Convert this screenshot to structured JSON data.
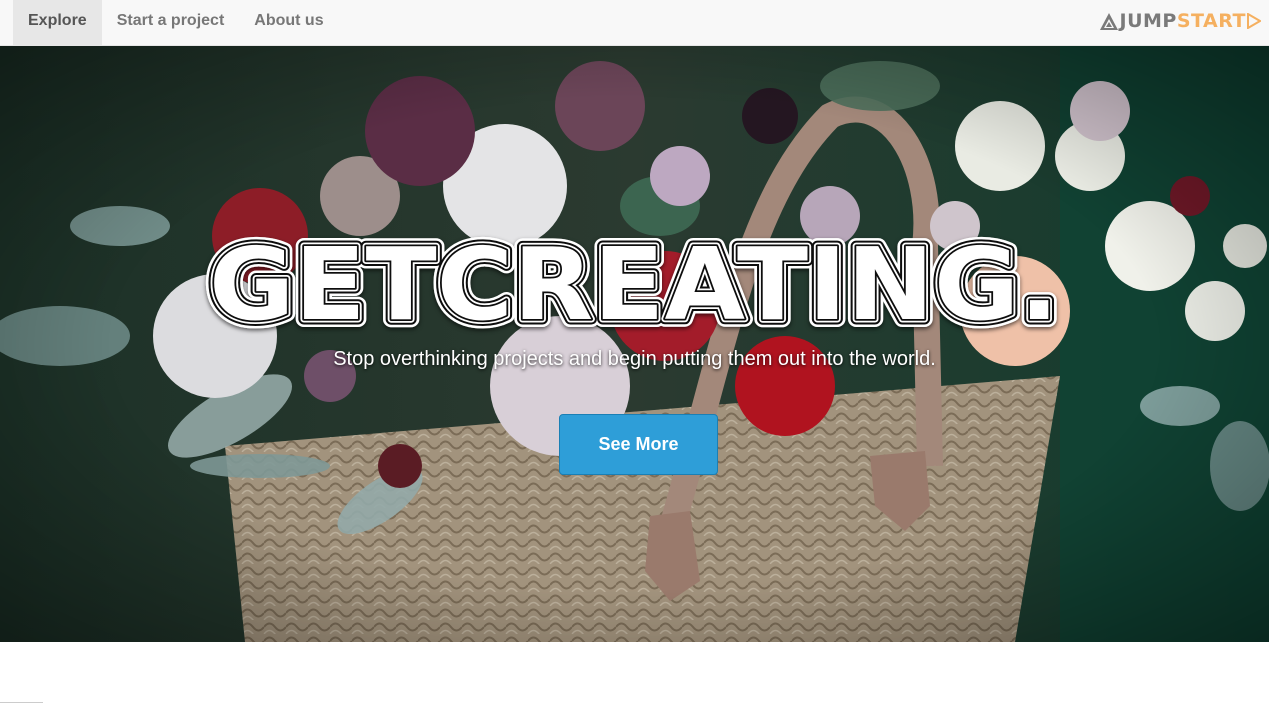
{
  "nav": {
    "items": [
      {
        "label": "Explore",
        "active": true
      },
      {
        "label": "Start a project",
        "active": false
      },
      {
        "label": "About us",
        "active": false
      }
    ],
    "brand": {
      "part1": "JUMP",
      "part2": "START",
      "color1": "#7a7a7a",
      "color2": "#f5b060"
    }
  },
  "hero": {
    "title": "GETCREATING.",
    "subtitle": "Stop overthinking projects and begin putting them out into the world.",
    "button_label": "See More",
    "button_color": "#2e9ed8"
  }
}
